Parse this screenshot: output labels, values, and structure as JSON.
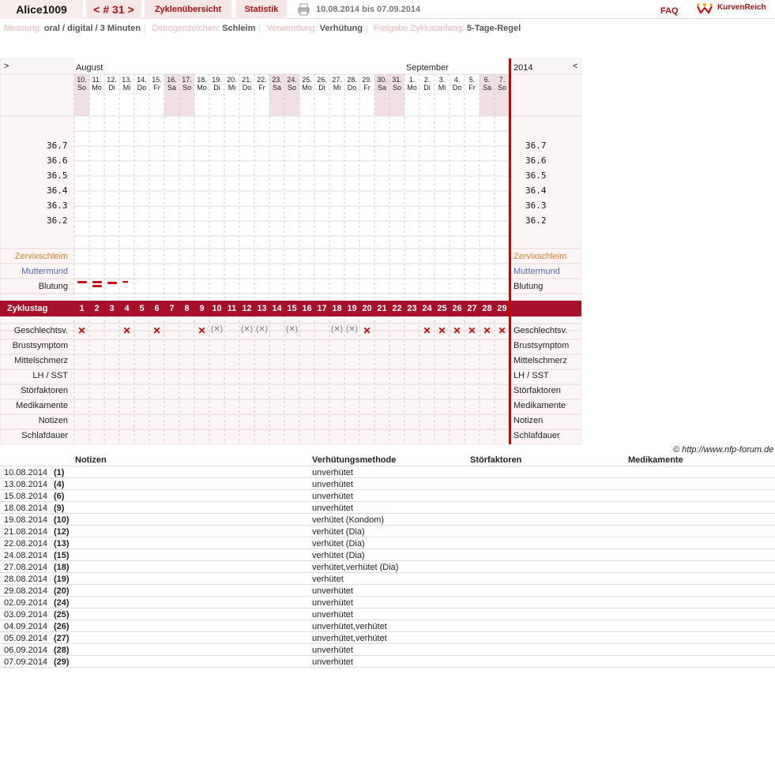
{
  "topbar": {
    "user": "Alice1009",
    "cycle": "< # 31 >",
    "overview": "Zyklenübersicht",
    "stats": "Statistik",
    "daterange": "10.08.2014 bis 07.09.2014",
    "faq": "FAQ",
    "brand": "KurvenReich"
  },
  "info": {
    "mess_k": "Messung:",
    "mess_v": "oral / digital / 3 Minuten",
    "oes_k": "Östrogenzeichen:",
    "oes_v": "Schleim",
    "verw_k": "Verwendung:",
    "verw_v": "Verhütung",
    "frei_k": "Freigabe Zyklusanfang:",
    "frei_v": "5-Tage-Regel"
  },
  "chart": {
    "nav_left": ">",
    "nav_right": "<",
    "month1": "August",
    "month2": "September",
    "year": "2014",
    "days": [
      [
        "10.",
        "So"
      ],
      [
        "11.",
        "Mo"
      ],
      [
        "12.",
        "Di"
      ],
      [
        "13.",
        "Mi"
      ],
      [
        "14.",
        "Do"
      ],
      [
        "15.",
        "Fr"
      ],
      [
        "16.",
        "Sa"
      ],
      [
        "17.",
        "So"
      ],
      [
        "18.",
        "Mo"
      ],
      [
        "19.",
        "Di"
      ],
      [
        "20.",
        "Mi"
      ],
      [
        "21.",
        "Do"
      ],
      [
        "22.",
        "Fr"
      ],
      [
        "23.",
        "Sa"
      ],
      [
        "24.",
        "So"
      ],
      [
        "25.",
        "Mo"
      ],
      [
        "26.",
        "Di"
      ],
      [
        "27.",
        "Mi"
      ],
      [
        "28.",
        "Do"
      ],
      [
        "29.",
        "Fr"
      ],
      [
        "30.",
        "Sa"
      ],
      [
        "31.",
        "So"
      ],
      [
        "1.",
        "Mo"
      ],
      [
        "2.",
        "Di"
      ],
      [
        "3.",
        "Mi"
      ],
      [
        "4.",
        "Do"
      ],
      [
        "5.",
        "Fr"
      ],
      [
        "6.",
        "Sa"
      ],
      [
        "7.",
        "So"
      ]
    ],
    "weekend_cols": [
      0,
      6,
      7,
      13,
      14,
      20,
      21,
      27,
      28
    ],
    "temp_labels": [
      "36.7",
      "36.6",
      "36.5",
      "36.4",
      "36.3",
      "36.2"
    ],
    "rows_top": [
      "Zervixschleim",
      "Muttermund",
      "Blutung"
    ],
    "cycle_label": "Zyklustag",
    "cycle_days": [
      "1",
      "2",
      "3",
      "4",
      "5",
      "6",
      "7",
      "8",
      "9",
      "10",
      "11",
      "12",
      "13",
      "14",
      "15",
      "16",
      "17",
      "18",
      "19",
      "20",
      "21",
      "22",
      "23",
      "24",
      "25",
      "26",
      "27",
      "28",
      "29"
    ],
    "rows_bottom": [
      "Geschlechtsv.",
      "Brustsymptom",
      "Mittelschmerz",
      "LH / SST",
      "Störfaktoren",
      "Medikamente",
      "Notizen",
      "Schlafdauer"
    ],
    "sex_marks": [
      {
        "day": 1,
        "m": "✕"
      },
      {
        "day": 4,
        "m": "✕"
      },
      {
        "day": 6,
        "m": "✕"
      },
      {
        "day": 9,
        "m": "✕"
      },
      {
        "day": 10,
        "m": "(✕)"
      },
      {
        "day": 12,
        "m": "(✕)"
      },
      {
        "day": 13,
        "m": "(✕)"
      },
      {
        "day": 15,
        "m": "(✕)"
      },
      {
        "day": 18,
        "m": "(✕)"
      },
      {
        "day": 19,
        "m": "(✕)"
      },
      {
        "day": 20,
        "m": "✕"
      },
      {
        "day": 24,
        "m": "✕"
      },
      {
        "day": 25,
        "m": "✕"
      },
      {
        "day": 26,
        "m": "✕"
      },
      {
        "day": 27,
        "m": "✕"
      },
      {
        "day": 28,
        "m": "✕"
      },
      {
        "day": 29,
        "m": "✕"
      }
    ],
    "copyright": "© http://www.nfp-forum.de"
  },
  "notes": {
    "h_notes": "Notizen",
    "h_method": "Verhütungsmethode",
    "h_stoer": "Störfaktoren",
    "h_med": "Medikamente",
    "rows": [
      [
        "10.08.2014",
        "(1)",
        "unverhütet"
      ],
      [
        "13.08.2014",
        "(4)",
        "unverhütet"
      ],
      [
        "15.08.2014",
        "(6)",
        "unverhütet"
      ],
      [
        "18.08.2014",
        "(9)",
        "unverhütet"
      ],
      [
        "19.08.2014",
        "(10)",
        "verhütet (Kondom)"
      ],
      [
        "21.08.2014",
        "(12)",
        "verhütet (Dia)"
      ],
      [
        "22.08.2014",
        "(13)",
        "verhütet (Dia)"
      ],
      [
        "24.08.2014",
        "(15)",
        "verhütet (Dia)"
      ],
      [
        "27.08.2014",
        "(18)",
        "verhütet,verhütet (Dia)"
      ],
      [
        "28.08.2014",
        "(19)",
        "verhütet"
      ],
      [
        "29.08.2014",
        "(20)",
        "unverhütet"
      ],
      [
        "02.09.2014",
        "(24)",
        "unverhütet"
      ],
      [
        "03.09.2014",
        "(25)",
        "unverhütet"
      ],
      [
        "04.09.2014",
        "(26)",
        "unverhütet,verhütet"
      ],
      [
        "05.09.2014",
        "(27)",
        "unverhütet,verhütet"
      ],
      [
        "06.09.2014",
        "(28)",
        "unverhütet"
      ],
      [
        "07.09.2014",
        "(29)",
        "unverhütet"
      ]
    ]
  }
}
